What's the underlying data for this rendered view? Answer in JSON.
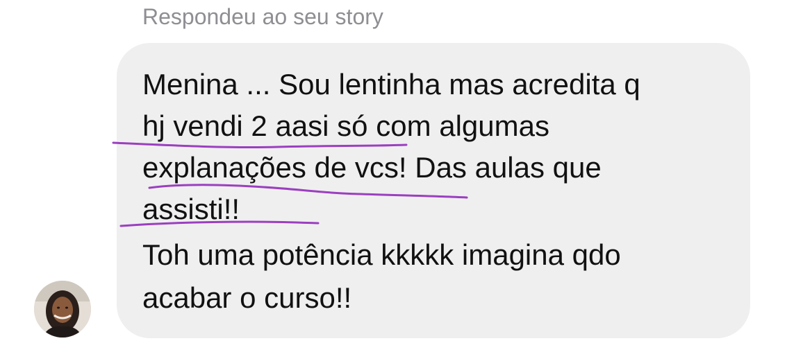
{
  "reply_caption": "Respondeu ao seu story",
  "message": {
    "lines": [
      "Menina ... Sou lentinha mas acredita q",
      "hj vendi 2 aasi só com algumas",
      "explanações de vcs! Das aulas que",
      "assisti!!",
      "Toh uma potência kkkkk imagina qdo",
      "acabar o curso!!"
    ]
  },
  "sender": {
    "avatar_icon": "profile-photo"
  },
  "colors": {
    "bubble_background": "#efefef",
    "caption_text": "#8e8e93",
    "message_text": "#111111",
    "underline_marks": "#9b3fc0"
  }
}
